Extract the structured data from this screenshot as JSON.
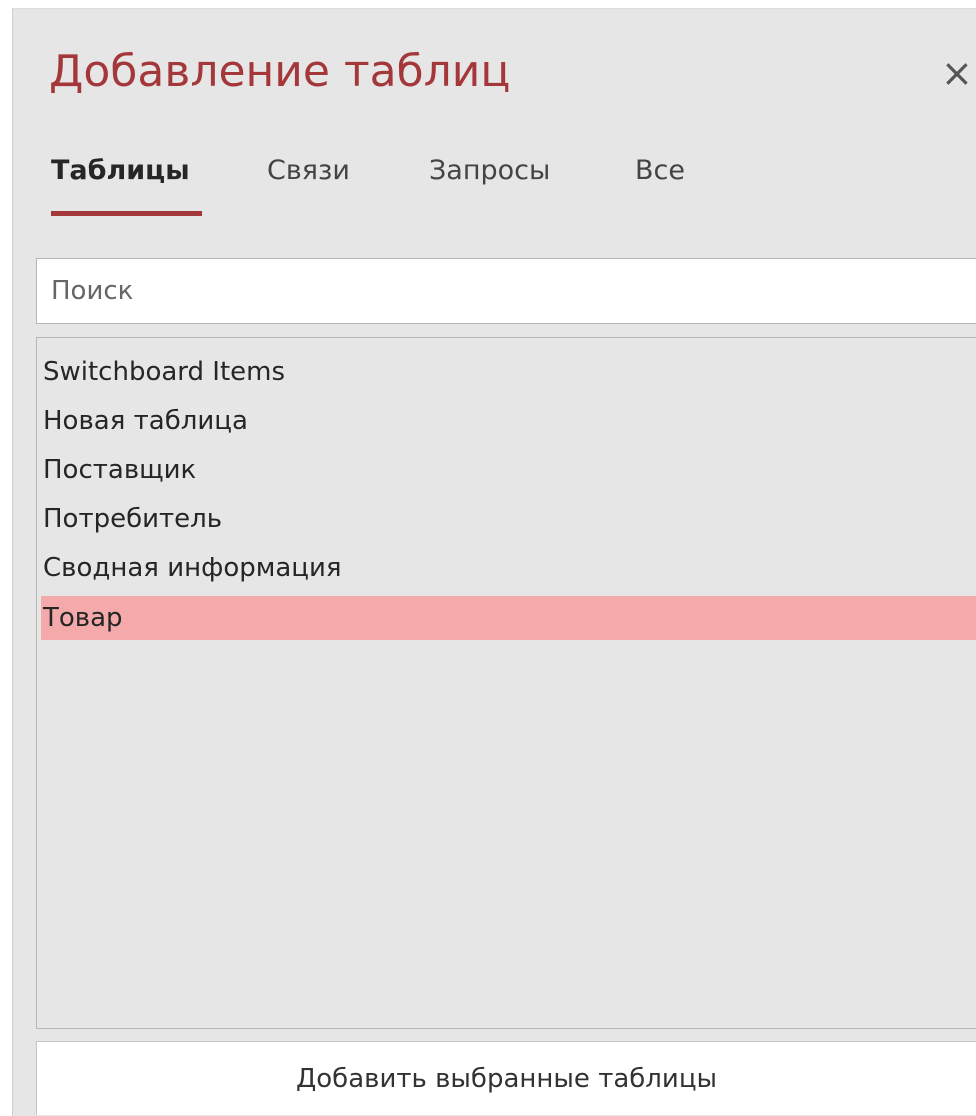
{
  "panel": {
    "title": "Добавление таблиц",
    "close_glyph": "×",
    "close_icon": "close-icon"
  },
  "tabs": [
    {
      "label": "Таблицы",
      "active": true
    },
    {
      "label": "Связи",
      "active": false
    },
    {
      "label": "Запросы",
      "active": false
    },
    {
      "label": "Все",
      "active": false
    }
  ],
  "search": {
    "placeholder": "Поиск",
    "value": ""
  },
  "list": {
    "items": [
      {
        "label": "Switchboard Items",
        "selected": false
      },
      {
        "label": "Новая таблица",
        "selected": false
      },
      {
        "label": "Поставщик",
        "selected": false
      },
      {
        "label": "Потребитель",
        "selected": false
      },
      {
        "label": "Сводная информация",
        "selected": false
      },
      {
        "label": "Товар",
        "selected": true
      }
    ]
  },
  "actions": {
    "add_selected_label": "Добавить выбранные таблицы"
  },
  "colors": {
    "accent": "#a4373a",
    "selection": "#f4a9aa",
    "panel_background": "#e6e6e6"
  }
}
